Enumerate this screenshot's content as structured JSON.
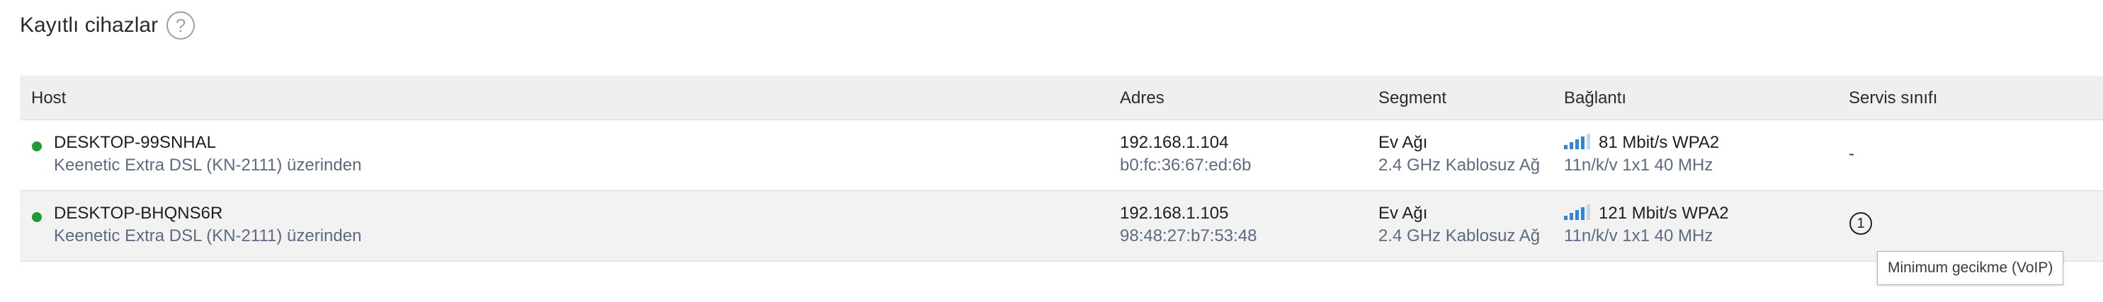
{
  "section": {
    "title": "Kayıtlı cihazlar",
    "help_glyph": "?"
  },
  "table": {
    "headers": {
      "host": "Host",
      "address": "Adres",
      "segment": "Segment",
      "connection": "Bağlantı",
      "service_class": "Servis sınıfı"
    },
    "rows": [
      {
        "status_color": "#1f9a38",
        "host_name": "DESKTOP-99SNHAL",
        "host_via": "Keenetic Extra DSL (KN-2111) üzerinden",
        "ip": "192.168.1.104",
        "mac": "b0:fc:36:67:ed:6b",
        "segment_name": "Ev Ağı",
        "segment_band": "2.4 GHz Kablosuz Ağ",
        "signal_bars": 4,
        "link": "81 Mbit/s WPA2",
        "mode": "11n/k/v 1x1 40 MHz",
        "service_class": "-"
      },
      {
        "status_color": "#1f9a38",
        "host_name": "DESKTOP-BHQNS6R",
        "host_via": "Keenetic Extra DSL (KN-2111) üzerinden",
        "ip": "192.168.1.105",
        "mac": "98:48:27:b7:53:48",
        "segment_name": "Ev Ağı",
        "segment_band": "2.4 GHz Kablosuz Ağ",
        "signal_bars": 4,
        "link": "121 Mbit/s WPA2",
        "mode": "11n/k/v 1x1 40 MHz",
        "service_class_icon": "number-one-circle-icon",
        "service_class_glyph": "1",
        "tooltip": "Minimum gecikme (VoIP)"
      }
    ]
  },
  "colors": {
    "signal_active": "#2f86d6",
    "signal_inactive": "#c8d6e4",
    "secondary_text": "#5c6b80",
    "header_bg": "#efefef"
  }
}
